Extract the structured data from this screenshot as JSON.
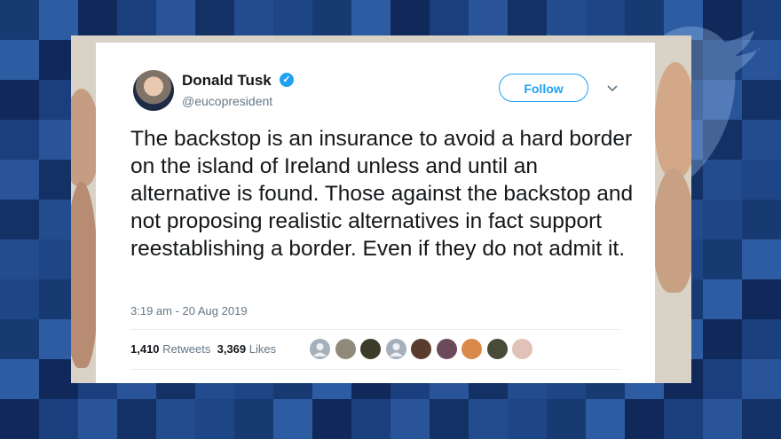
{
  "tweet": {
    "author_name": "Donald Tusk",
    "handle": "@eucopresident",
    "follow_label": "Follow",
    "text": "The backstop is an insurance to avoid a hard border on the island of Ireland unless and until an alternative is found. Those against the backstop and not proposing realistic alternatives in fact support reestablishing a border. Even if they do not admit it.",
    "timestamp": "3:19 am - 20 Aug 2019",
    "retweets_count": "1,410",
    "retweets_label": "Retweets",
    "likes_count": "3,369",
    "likes_label": "Likes",
    "liker_avatars": [
      "default-avatar",
      "photo-avatar",
      "photo-avatar",
      "default-avatar",
      "photo-avatar",
      "photo-avatar",
      "photo-avatar",
      "photo-avatar",
      "photo-avatar"
    ]
  },
  "icons": {
    "verified": "verified-badge-icon",
    "dropdown": "chevron-down-icon",
    "watermark": "twitter-bird-icon"
  },
  "colors": {
    "accent": "#1da1f2",
    "background": "#1b3d78"
  }
}
